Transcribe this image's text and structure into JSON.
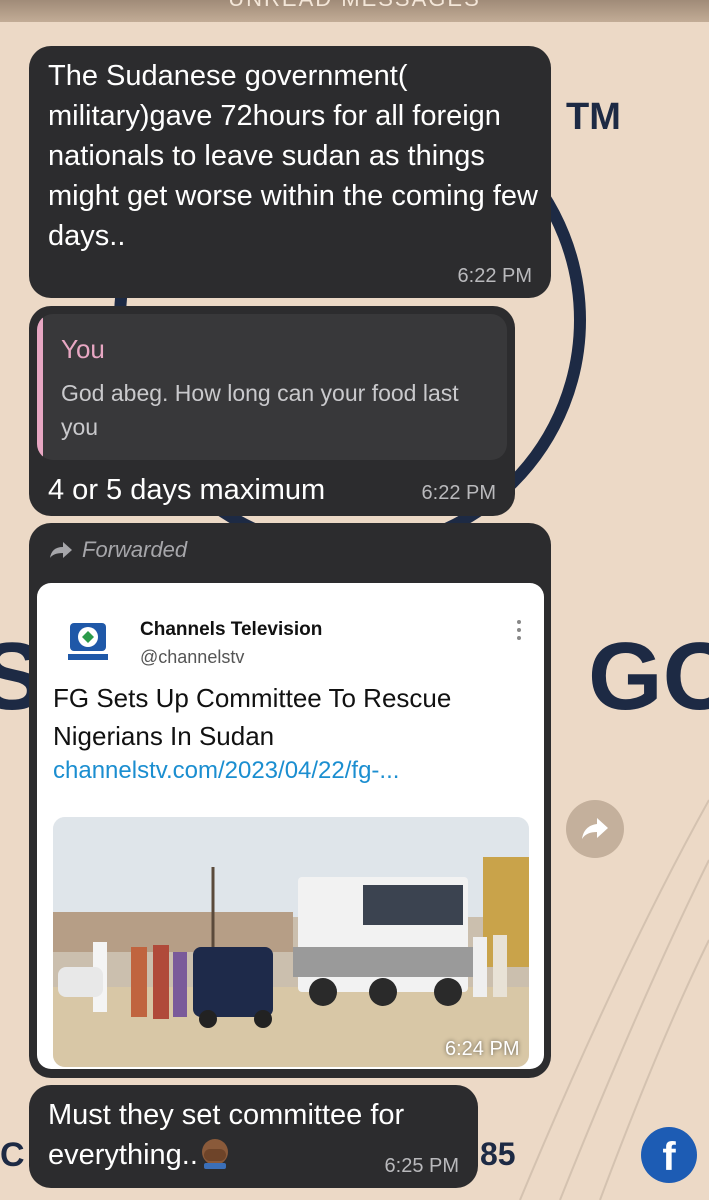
{
  "header": {
    "banner_text": "UNREAD MESSAGES"
  },
  "wallpaper": {
    "tm_mark": "TM",
    "left_letter": "S",
    "right_letters": "GOS",
    "bottom_left": "C",
    "bottom_right": "85"
  },
  "messages": [
    {
      "text": "The Sudanese government( military)gave 72hours for all foreign nationals to leave sudan as things might get worse within the coming few days..",
      "time": "6:22 PM"
    },
    {
      "reply_to": {
        "author": "You",
        "text": "God abeg. How long can your food last you"
      },
      "text": "4 or 5 days maximum",
      "time": "6:22 PM"
    },
    {
      "forwarded_label": "Forwarded",
      "link_preview": {
        "source_name": "Channels Television",
        "handle": "@channelstv",
        "title": "FG Sets Up Committee To Rescue Nigerians In Sudan",
        "url": "channelstv.com/2023/04/22/fg-..."
      },
      "time": "6:24 PM"
    },
    {
      "text": "Must they set committee for everything..",
      "emoji": "face-palm",
      "time": "6:25 PM"
    }
  ],
  "colors": {
    "background": "#ecd9c6",
    "bubble": "#2c2c2e",
    "quote_accent": "#e8a7c3",
    "link": "#1b8ed0",
    "facebook": "#1d5cb4"
  },
  "icons": {
    "forward": "forward-arrow-icon",
    "share": "share-arrow-icon",
    "kebab": "more-vertical-icon",
    "social": "facebook-icon"
  }
}
